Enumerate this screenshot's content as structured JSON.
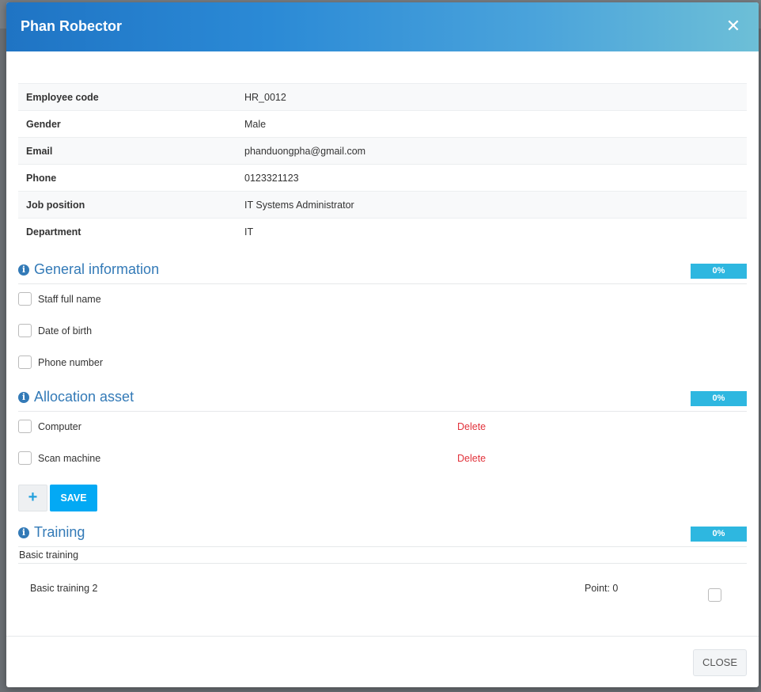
{
  "modal": {
    "title": "Phan Robector",
    "close_icon": "close-icon"
  },
  "employee_info": [
    {
      "label": "Employee code",
      "value": "HR_0012"
    },
    {
      "label": "Gender",
      "value": "Male"
    },
    {
      "label": "Email",
      "value": "phanduongpha@gmail.com"
    },
    {
      "label": "Phone",
      "value": "0123321123"
    },
    {
      "label": "Job position",
      "value": "IT Systems Administrator"
    },
    {
      "label": "Department",
      "value": "IT"
    }
  ],
  "general_information": {
    "title": "General information",
    "progress": "0%",
    "items": [
      {
        "label": "Staff full name",
        "checked": false
      },
      {
        "label": "Date of birth",
        "checked": false
      },
      {
        "label": "Phone number",
        "checked": false
      }
    ]
  },
  "allocation_asset": {
    "title": "Allocation asset",
    "progress": "0%",
    "items": [
      {
        "label": "Computer",
        "checked": false,
        "action": "Delete"
      },
      {
        "label": "Scan machine",
        "checked": false,
        "action": "Delete"
      }
    ],
    "add_label": "+",
    "save_label": "SAVE"
  },
  "training": {
    "title": "Training",
    "progress": "0%",
    "group": "Basic training",
    "items": [
      {
        "name": "Basic training 2",
        "point": "Point: 0",
        "checked": false
      }
    ]
  },
  "footer": {
    "close_label": "CLOSE"
  },
  "colors": {
    "accent": "#337ab7",
    "badge": "#2eb7e0",
    "save": "#03a9f4",
    "delete": "#e2323b"
  }
}
